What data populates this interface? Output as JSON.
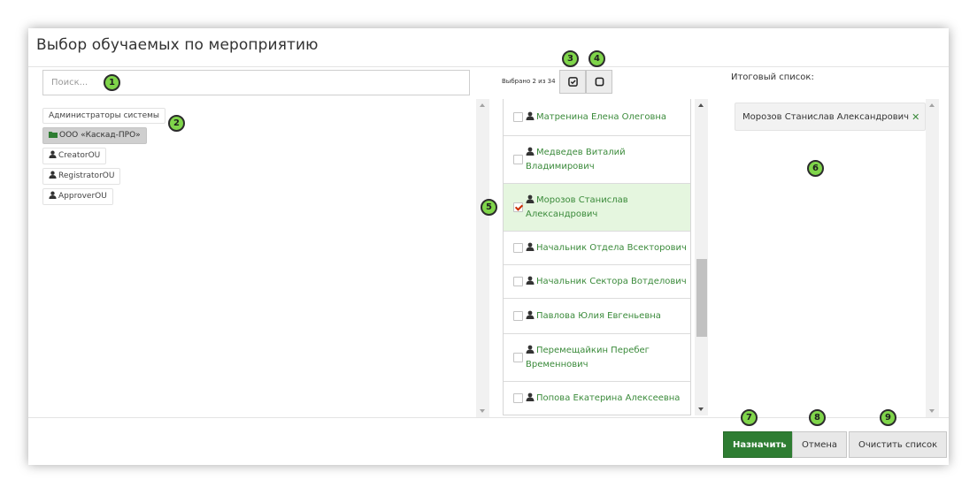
{
  "dialog": {
    "title": "Выбор обучаемых по мероприятию"
  },
  "search": {
    "placeholder": "Поиск..."
  },
  "tree": {
    "items": [
      {
        "label": "Администраторы системы",
        "icon": "none",
        "active": false
      },
      {
        "label": "ООО «Каскад-ПРО»",
        "icon": "folder-icon",
        "active": true
      },
      {
        "label": "CreatorOU",
        "icon": "user-icon",
        "active": false
      },
      {
        "label": "RegistratorOU",
        "icon": "user-icon",
        "active": false
      },
      {
        "label": "ApproverOU",
        "icon": "user-icon",
        "active": false
      }
    ]
  },
  "middle": {
    "selected_count": "Выбрано 2 из 34",
    "select_all_icon": "check-square-icon",
    "deselect_all_icon": "square-icon",
    "rows": [
      {
        "name": "Матренина Елена Олеговна",
        "checked": false
      },
      {
        "name": "Медведев Виталий Владимирович",
        "checked": false
      },
      {
        "name": "Морозов Станислав Александрович",
        "checked": true
      },
      {
        "name": "Начальник Отдела Всекторович",
        "checked": false
      },
      {
        "name": "Начальник Сектора Вотделович",
        "checked": false
      },
      {
        "name": "Павлова Юлия Евгеньевна",
        "checked": false
      },
      {
        "name": "Перемещайкин Перебег Временнович",
        "checked": false
      },
      {
        "name": "Попова Екатерина Алексеевна",
        "checked": false
      }
    ]
  },
  "final": {
    "label": "Итоговый список:",
    "chips": [
      {
        "name": "Морозов Станислав Александрович",
        "remove_icon": "close-icon"
      }
    ]
  },
  "footer": {
    "assign_label": "Назначить",
    "cancel_label": "Отмена",
    "clear_label": "Очистить список"
  },
  "badges": [
    "1",
    "2",
    "3",
    "4",
    "5",
    "6",
    "7",
    "8",
    "9"
  ],
  "colors": {
    "primary_green": "#2e7d32",
    "name_green": "#3a8a3a",
    "selected_row": "#e5f6df",
    "badge_green": "#7fd54a",
    "check_red": "#cc2d00"
  }
}
